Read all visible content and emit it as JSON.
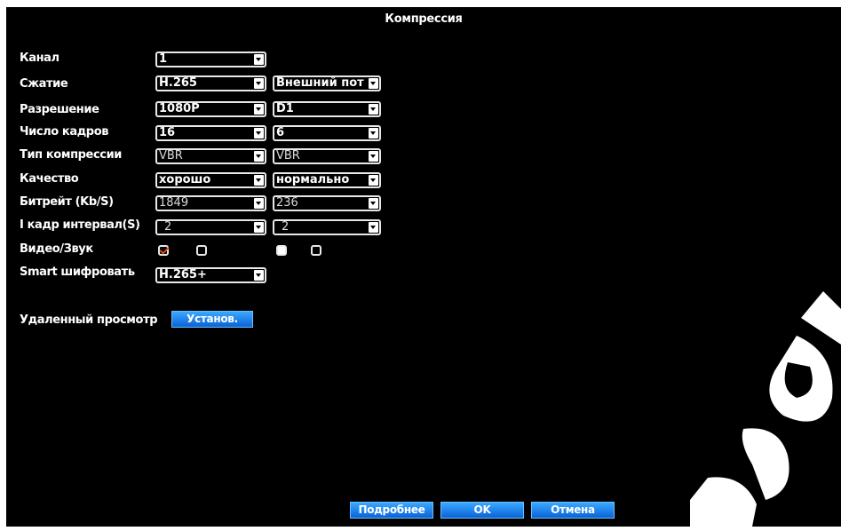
{
  "window": {
    "title": "Компрессия"
  },
  "form": {
    "channel": {
      "label": "Канал",
      "main": "1"
    },
    "compression": {
      "label": "Сжатие",
      "main": "H.265",
      "sub": "Внешний пот"
    },
    "resolution": {
      "label": "Разрешение",
      "main": "1080P",
      "sub": "D1"
    },
    "fps": {
      "label": "Число кадров",
      "main": "16",
      "sub": "6"
    },
    "comp_type": {
      "label": "Тип компрессии",
      "main": "VBR",
      "sub": "VBR"
    },
    "quality": {
      "label": "Качество",
      "main": "хорошо",
      "sub": "нормально"
    },
    "bitrate": {
      "label": "Битрейт (Kb/S)",
      "main": "1849",
      "sub": "236"
    },
    "iframe": {
      "label": "I кадр интервал(S)",
      "main": "2",
      "sub": "2"
    },
    "video_audio": {
      "label": "Видео/Звук",
      "main_video": true,
      "main_audio": false,
      "sub_video": true,
      "sub_audio": false
    },
    "smart": {
      "label": "Smart шифровать",
      "value": "H.265+"
    }
  },
  "remote": {
    "label": "Удаленный просмотр",
    "button": "Установ."
  },
  "footer": {
    "details": "Подробнее",
    "ok": "OK",
    "cancel": "Отмена"
  },
  "colors": {
    "background": "#000000",
    "button": "#1a7ff0",
    "text": "#ffffff",
    "check": "#d0501e"
  }
}
